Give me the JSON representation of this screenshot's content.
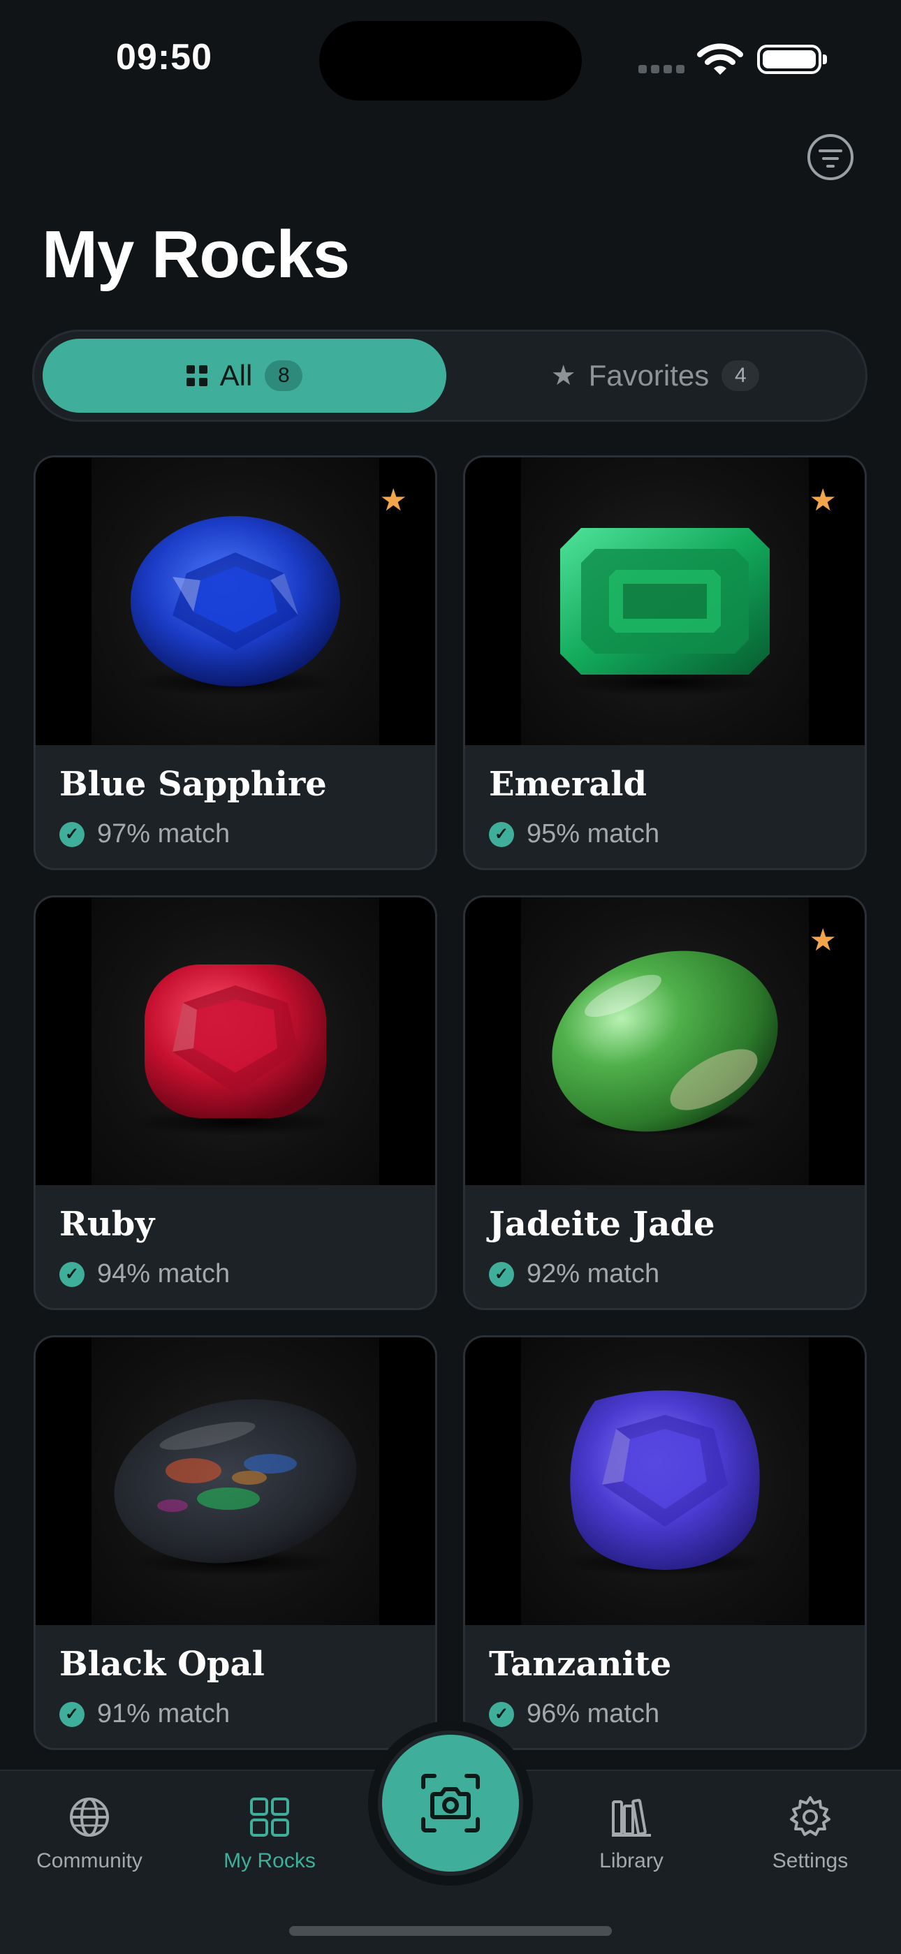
{
  "status_bar": {
    "time": "09:50"
  },
  "header": {
    "title": "My Rocks"
  },
  "segments": [
    {
      "label": "All",
      "count": "8",
      "icon": "grid-icon",
      "selected": true
    },
    {
      "label": "Favorites",
      "count": "4",
      "icon": "star-icon",
      "selected": false
    }
  ],
  "rocks": [
    {
      "name": "Blue Sapphire",
      "match": "97% match",
      "favorite": true
    },
    {
      "name": "Emerald",
      "match": "95% match",
      "favorite": true
    },
    {
      "name": "Ruby",
      "match": "94% match",
      "favorite": false
    },
    {
      "name": "Jadeite Jade",
      "match": "92% match",
      "favorite": true
    },
    {
      "name": "Black Opal",
      "match": "91% match",
      "favorite": false
    },
    {
      "name": "Tanzanite",
      "match": "96% match",
      "favorite": false
    }
  ],
  "tabbar": {
    "community": "Community",
    "my_rocks": "My Rocks",
    "library": "Library",
    "settings": "Settings"
  },
  "colors": {
    "accent": "#3fae9b",
    "star": "#f2a54b",
    "background": "#101417"
  }
}
